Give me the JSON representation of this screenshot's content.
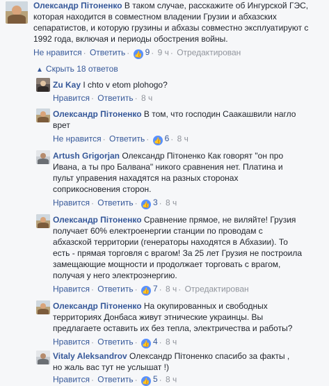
{
  "comments": [
    {
      "author": "Олександр Пітоненко",
      "lines": [
        " В таком случае, расскажите об Ингурской ГЭС,",
        "которая находится в совместном владении Грузии и абхазских",
        "сепаратистов, и которую грузины и абхазы совместно эксплуатируют с",
        "1992 года, включая и периоды обострения войны."
      ],
      "like": "Не нравится",
      "reply": "Ответить",
      "likes": "9",
      "time": "9 ч",
      "edited": "Отредактирован"
    }
  ],
  "toggle_label": "Скрыть 18 ответов",
  "replies": [
    {
      "author": "Zu Kay",
      "lines": [
        " I chto v etom plohogo?"
      ],
      "like": "Нравится",
      "reply": "Ответить",
      "likes": "",
      "time": "8 ч",
      "edited": ""
    },
    {
      "author": "Олександр Пітоненко",
      "lines": [
        " В том, что господин Саакашвили нагло",
        "врет"
      ],
      "like": "Не нравится",
      "reply": "Ответить",
      "likes": "6",
      "time": "8 ч",
      "edited": ""
    },
    {
      "author": "Artush Grigorjan",
      "lines": [
        " Олександр Пітоненко Как говорят \"он про",
        "Ивана, а ты про Балвана\" никого сравнения нет. Платина и",
        "пульт управения нахадятся на разных сторонах",
        "соприкосновения сторон."
      ],
      "like": "Нравится",
      "reply": "Ответить",
      "likes": "3",
      "time": "8 ч",
      "edited": ""
    },
    {
      "author": "Олександр Пітоненко",
      "lines": [
        " Сравнение прямое, не виляйте! Грузия",
        "получает 60% електроенергии станции по проводам с",
        "абхазской территории (генераторы находятся в Абхазии). То",
        "есть - прямая торговля с врагом! За 25 лет Грузия не построила",
        "замещающие мощности и продолжает торговать с врагом,",
        "получая у него электроэнергию."
      ],
      "like": "Нравится",
      "reply": "Ответить",
      "likes": "7",
      "time": "8 ч",
      "edited": "Отредактирован"
    },
    {
      "author": "Олександр Пітоненко",
      "lines": [
        " На окупированных и свободных",
        "территориях Донбаса живут этнические украинцы. Вы",
        "предлагаете оставить их без тепла, электричества и работы?"
      ],
      "like": "Нравится",
      "reply": "Ответить",
      "likes": "4",
      "time": "8 ч",
      "edited": ""
    },
    {
      "author": "Vitaly Aleksandrov",
      "lines": [
        " Олександр Пітоненко спасибо за факты ,",
        "но жаль вас тут не услышат !)"
      ],
      "like": "Нравится",
      "reply": "Ответить",
      "likes": "5",
      "time": "8 ч",
      "edited": ""
    }
  ]
}
